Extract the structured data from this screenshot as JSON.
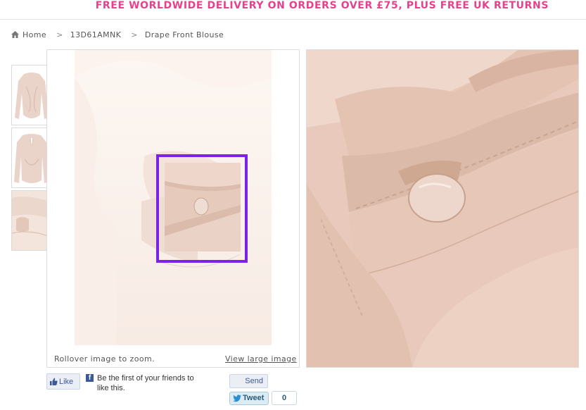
{
  "promo_banner": "FREE WORLDWIDE DELIVERY ON ORDERS OVER £75, PLUS FREE UK RETURNS",
  "breadcrumb": {
    "items": [
      "Home",
      "13D61AMNK",
      "Drape Front Blouse"
    ],
    "separator": ">"
  },
  "product_gallery": {
    "thumbnails": [
      "front-view",
      "back-view",
      "sleeve-detail"
    ],
    "rollover_hint": "Rollover image to zoom.",
    "view_large_label": "View large image"
  },
  "social": {
    "like_label": "Like",
    "like_prompt": "Be the first of your friends to like this.",
    "send_label": "Send",
    "tweet_label": "Tweet",
    "tweet_count": "0"
  },
  "colors": {
    "promo_pink": "#e8408c",
    "lens_purple": "#7b22e8",
    "fabric_blush": "#e9cbbd"
  },
  "icons": [
    "home-icon",
    "facebook-thumb-icon",
    "facebook-f-icon",
    "twitter-bird-icon"
  ]
}
